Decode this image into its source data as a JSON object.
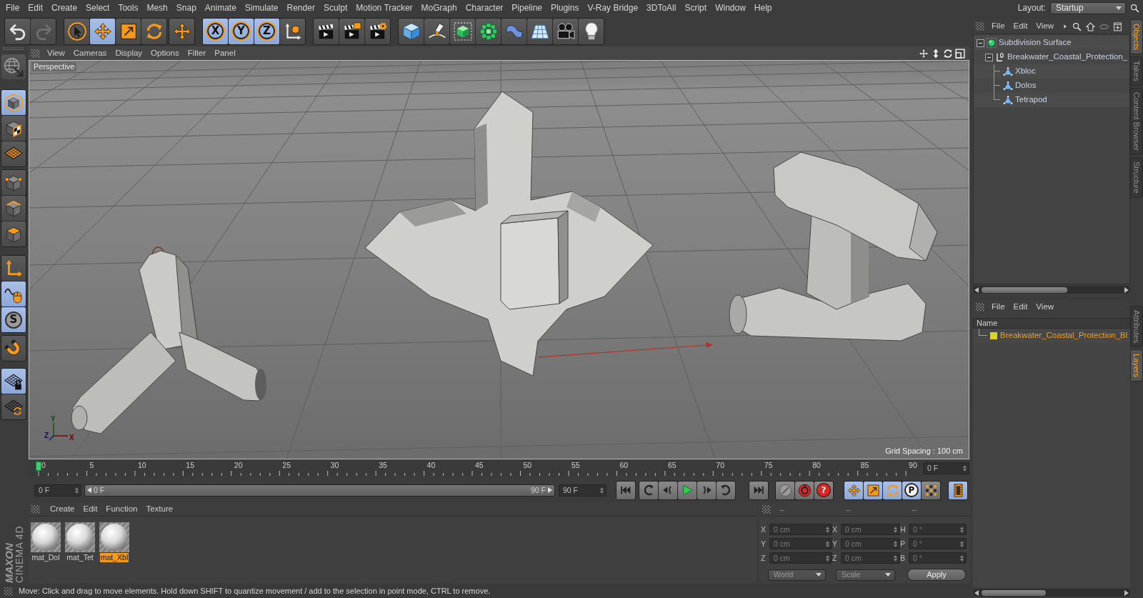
{
  "menu_bar": {
    "items": [
      "File",
      "Edit",
      "Create",
      "Select",
      "Tools",
      "Mesh",
      "Snap",
      "Animate",
      "Simulate",
      "Render",
      "Sculpt",
      "Motion Tracker",
      "MoGraph",
      "Character",
      "Pipeline",
      "Plugins",
      "V-Ray Bridge",
      "3DToAll",
      "Script",
      "Window",
      "Help"
    ],
    "layout_label": "Layout:",
    "layout_value": "Startup"
  },
  "toolbar": {
    "history": [
      {
        "kind": "undo",
        "disabled": false
      },
      {
        "kind": "redo",
        "disabled": true
      }
    ],
    "tools": [
      {
        "kind": "select",
        "selected": false
      },
      {
        "kind": "move",
        "selected": true
      },
      {
        "kind": "scale",
        "selected": false
      },
      {
        "kind": "rotate",
        "selected": false
      }
    ],
    "recent": [
      {
        "kind": "move",
        "selected": false
      }
    ],
    "axes": [
      {
        "kind": "axis",
        "label": "X",
        "selected": true
      },
      {
        "kind": "axis",
        "label": "Y",
        "selected": true
      },
      {
        "kind": "axis",
        "label": "Z",
        "selected": true
      },
      {
        "kind": "coordinates",
        "selected": false
      }
    ],
    "render": [
      {
        "kind": "render-view"
      },
      {
        "kind": "render-picture"
      },
      {
        "kind": "render-settings"
      }
    ],
    "create": [
      {
        "kind": "cube"
      },
      {
        "kind": "pen"
      },
      {
        "kind": "subdivision"
      },
      {
        "kind": "cloner"
      },
      {
        "kind": "bend"
      },
      {
        "kind": "floor"
      },
      {
        "kind": "camera"
      },
      {
        "kind": "light"
      }
    ]
  },
  "left_toolbar": [
    [
      {
        "kind": "convert",
        "selected": false
      }
    ],
    [
      {
        "kind": "model",
        "selected": true
      },
      {
        "kind": "texture",
        "selected": false
      },
      {
        "kind": "workplane",
        "selected": false
      }
    ],
    [
      {
        "kind": "points",
        "selected": false
      },
      {
        "kind": "edges",
        "selected": false
      },
      {
        "kind": "polygons",
        "selected": false
      }
    ],
    [
      {
        "kind": "axis",
        "selected": false
      },
      {
        "kind": "tweak",
        "selected": true
      },
      {
        "kind": "soft-selection",
        "glyph": "S",
        "selected": true
      }
    ],
    [
      {
        "kind": "snap",
        "selected": false
      }
    ],
    [
      {
        "kind": "workplane-lock",
        "selected": true
      },
      {
        "kind": "workplane-align",
        "selected": false
      }
    ]
  ],
  "viewport": {
    "menu": [
      "View",
      "Cameras",
      "Display",
      "Options",
      "Filter",
      "Panel"
    ],
    "camera": "Perspective",
    "grid_spacing": "Grid Spacing : 100 cm",
    "gizmo_labels": [
      "Y",
      "Z",
      "X"
    ]
  },
  "timeline": {
    "ticks": [
      "0",
      "5",
      "10",
      "15",
      "20",
      "25",
      "30",
      "35",
      "40",
      "45",
      "50",
      "55",
      "60",
      "65",
      "70",
      "75",
      "80",
      "85",
      "90"
    ],
    "level": 0,
    "current_frame": "0 F"
  },
  "transport": {
    "start": "0 F",
    "range": {
      "start": "0 F",
      "end": "90 F",
      "level": 1
    },
    "end": "90 F",
    "playback": [
      [
        {
          "kind": "first"
        }
      ],
      [
        {
          "kind": "prev-key"
        },
        {
          "kind": "prev-frame"
        },
        {
          "kind": "play"
        },
        {
          "kind": "next-frame"
        },
        {
          "kind": "next-key"
        }
      ],
      [
        {
          "kind": "last"
        }
      ]
    ],
    "record": [
      {
        "kind": "keyframe-off"
      },
      {
        "kind": "record"
      },
      {
        "kind": "autokey",
        "glyph": "?"
      }
    ],
    "key_tracks": [
      {
        "kind": "position",
        "selected": true
      },
      {
        "kind": "scale",
        "selected": true
      },
      {
        "kind": "rotation",
        "selected": true
      },
      {
        "kind": "parameter",
        "glyph": "P",
        "selected": true
      },
      {
        "kind": "point-level",
        "selected": false
      }
    ],
    "timeline_button": {
      "selected": true
    }
  },
  "materials": {
    "menu": [
      "Create",
      "Edit",
      "Function",
      "Texture"
    ],
    "items": [
      {
        "name": "mat_Dol",
        "selected": false
      },
      {
        "name": "mat_Tet",
        "selected": false
      },
      {
        "name": "mat_Xbl",
        "selected": true
      }
    ]
  },
  "coordinates": {
    "headers": [
      "--",
      "--",
      "--"
    ],
    "columns": [
      [
        {
          "axis": "X",
          "value": "0 cm"
        },
        {
          "axis": "Y",
          "value": "0 cm"
        },
        {
          "axis": "Z",
          "value": "0 cm"
        }
      ],
      [
        {
          "axis": "X",
          "value": "0 cm"
        },
        {
          "axis": "Y",
          "value": "0 cm"
        },
        {
          "axis": "Z",
          "value": "0 cm"
        }
      ],
      [
        {
          "axis": "H",
          "value": "0 °"
        },
        {
          "axis": "P",
          "value": "0 °"
        },
        {
          "axis": "B",
          "value": "0 °"
        }
      ]
    ],
    "space": "World",
    "mode": "Scale",
    "apply": "Apply"
  },
  "status_bar": "Move: Click and drag to move elements. Hold down SHIFT to quantize movement / add to the selection in point mode, CTRL to remove.",
  "logo": {
    "brand": "MAXON",
    "product": "CINEMA 4D"
  },
  "objects": {
    "menu": [
      "File",
      "Edit",
      "View"
    ],
    "tree": [
      {
        "name": "Subdivision Surface",
        "kind": "subdivision",
        "expanded": true,
        "children": [
          {
            "name": "Breakwater_Coastal_Protection_",
            "kind": "null",
            "expanded": true,
            "children": [
              {
                "name": "Xbloc",
                "kind": "polygon"
              },
              {
                "name": "Dolos",
                "kind": "polygon"
              },
              {
                "name": "Tetrapod",
                "kind": "polygon"
              }
            ]
          }
        ]
      }
    ]
  },
  "layers": {
    "menu": [
      "File",
      "Edit",
      "View"
    ],
    "header": "Name",
    "rows": [
      {
        "name": "Breakwater_Coastal_Protection_Bl",
        "color": "#d8d22c"
      }
    ]
  },
  "side_tabs": {
    "upper": [
      {
        "label": "Objects",
        "selected": true
      },
      {
        "label": "Takes",
        "selected": false
      },
      {
        "label": "Content Browser",
        "selected": false
      },
      {
        "label": "Structure",
        "selected": false
      }
    ],
    "lower": [
      {
        "label": "Attributes",
        "selected": false
      },
      {
        "label": "Layers",
        "selected": true
      }
    ]
  }
}
